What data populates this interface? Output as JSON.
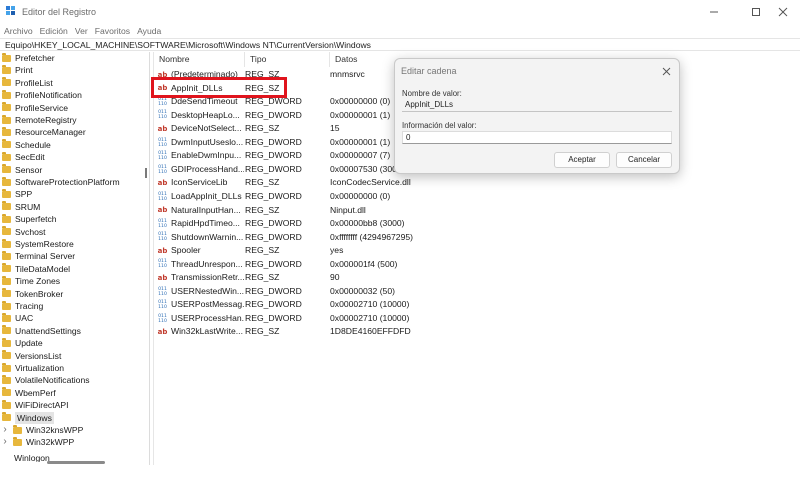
{
  "window": {
    "title": "Editor del Registro"
  },
  "menu": [
    "Archivo",
    "Edición",
    "Ver",
    "Favoritos",
    "Ayuda"
  ],
  "address": "Equipo\\HKEY_LOCAL_MACHINE\\SOFTWARE\\Microsoft\\Windows NT\\CurrentVersion\\Windows",
  "tree": {
    "items": [
      "Prefetcher",
      "Print",
      "ProfileList",
      "ProfileNotification",
      "ProfileService",
      "RemoteRegistry",
      "ResourceManager",
      "Schedule",
      "SecEdit",
      "Sensor",
      "SoftwareProtectionPlatform",
      "SPP",
      "SRUM",
      "Superfetch",
      "Svchost",
      "SystemRestore",
      "Terminal Server",
      "TileDataModel",
      "Time Zones",
      "TokenBroker",
      "Tracing",
      "UAC",
      "UnattendSettings",
      "Update",
      "VersionsList",
      "Virtualization",
      "VolatileNotifications",
      "WbemPerf",
      "WiFiDirectAPI",
      "Windows"
    ],
    "children": [
      "Win32knsWPP",
      "Win32kWPP"
    ],
    "partial": "Winlogon",
    "selected": "Windows"
  },
  "list": {
    "headers": {
      "name": "Nombre",
      "type": "Tipo",
      "data": "Datos"
    },
    "rows": [
      {
        "icon": "string-value-icon",
        "name": "(Predeterminado)",
        "type": "REG_SZ",
        "data": "mnmsrvc"
      },
      {
        "icon": "string-value-icon",
        "name": "AppInit_DLLs",
        "type": "REG_SZ",
        "data": ""
      },
      {
        "icon": "dword-value-icon",
        "name": "DdeSendTimeout",
        "type": "REG_DWORD",
        "data": "0x00000000 (0)"
      },
      {
        "icon": "dword-value-icon",
        "name": "DesktopHeapLo...",
        "type": "REG_DWORD",
        "data": "0x00000001 (1)"
      },
      {
        "icon": "string-value-icon",
        "name": "DeviceNotSelect...",
        "type": "REG_SZ",
        "data": "15"
      },
      {
        "icon": "dword-value-icon",
        "name": "DwmInputUseslo...",
        "type": "REG_DWORD",
        "data": "0x00000001 (1)"
      },
      {
        "icon": "dword-value-icon",
        "name": "EnableDwmInpu...",
        "type": "REG_DWORD",
        "data": "0x00000007 (7)"
      },
      {
        "icon": "dword-value-icon",
        "name": "GDIProcessHand...",
        "type": "REG_DWORD",
        "data": "0x00007530 (30000)"
      },
      {
        "icon": "string-value-icon",
        "name": "IconServiceLib",
        "type": "REG_SZ",
        "data": "IconCodecService.dll"
      },
      {
        "icon": "dword-value-icon",
        "name": "LoadAppInit_DLLs",
        "type": "REG_DWORD",
        "data": "0x00000000 (0)"
      },
      {
        "icon": "string-value-icon",
        "name": "NaturalInputHan...",
        "type": "REG_SZ",
        "data": "Ninput.dll"
      },
      {
        "icon": "dword-value-icon",
        "name": "RapidHpdTimeo...",
        "type": "REG_DWORD",
        "data": "0x00000bb8 (3000)"
      },
      {
        "icon": "dword-value-icon",
        "name": "ShutdownWarnin...",
        "type": "REG_DWORD",
        "data": "0xffffffff (4294967295)"
      },
      {
        "icon": "string-value-icon",
        "name": "Spooler",
        "type": "REG_SZ",
        "data": "yes"
      },
      {
        "icon": "dword-value-icon",
        "name": "ThreadUnrespon...",
        "type": "REG_DWORD",
        "data": "0x000001f4 (500)"
      },
      {
        "icon": "string-value-icon",
        "name": "TransmissionRetr...",
        "type": "REG_SZ",
        "data": "90"
      },
      {
        "icon": "dword-value-icon",
        "name": "USERNestedWin...",
        "type": "REG_DWORD",
        "data": "0x00000032 (50)"
      },
      {
        "icon": "dword-value-icon",
        "name": "USERPostMessag...",
        "type": "REG_DWORD",
        "data": "0x00002710 (10000)"
      },
      {
        "icon": "dword-value-icon",
        "name": "USERProcessHan...",
        "type": "REG_DWORD",
        "data": "0x00002710 (10000)"
      },
      {
        "icon": "string-value-icon",
        "name": "Win32kLastWrite...",
        "type": "REG_SZ",
        "data": "1D8DE4160EFFDFD"
      }
    ]
  },
  "dialog": {
    "title": "Editar cadena",
    "name_label": "Nombre de valor:",
    "name_value": "AppInit_DLLs",
    "data_label": "Información del valor:",
    "data_value": "0",
    "ok_label": "Aceptar",
    "cancel_label": "Cancelar"
  },
  "colors": {
    "highlight": "#e0141d",
    "folder": "#e7b73c",
    "string_icon": "#c0392b",
    "dword_icon": "#2f6fb5"
  }
}
